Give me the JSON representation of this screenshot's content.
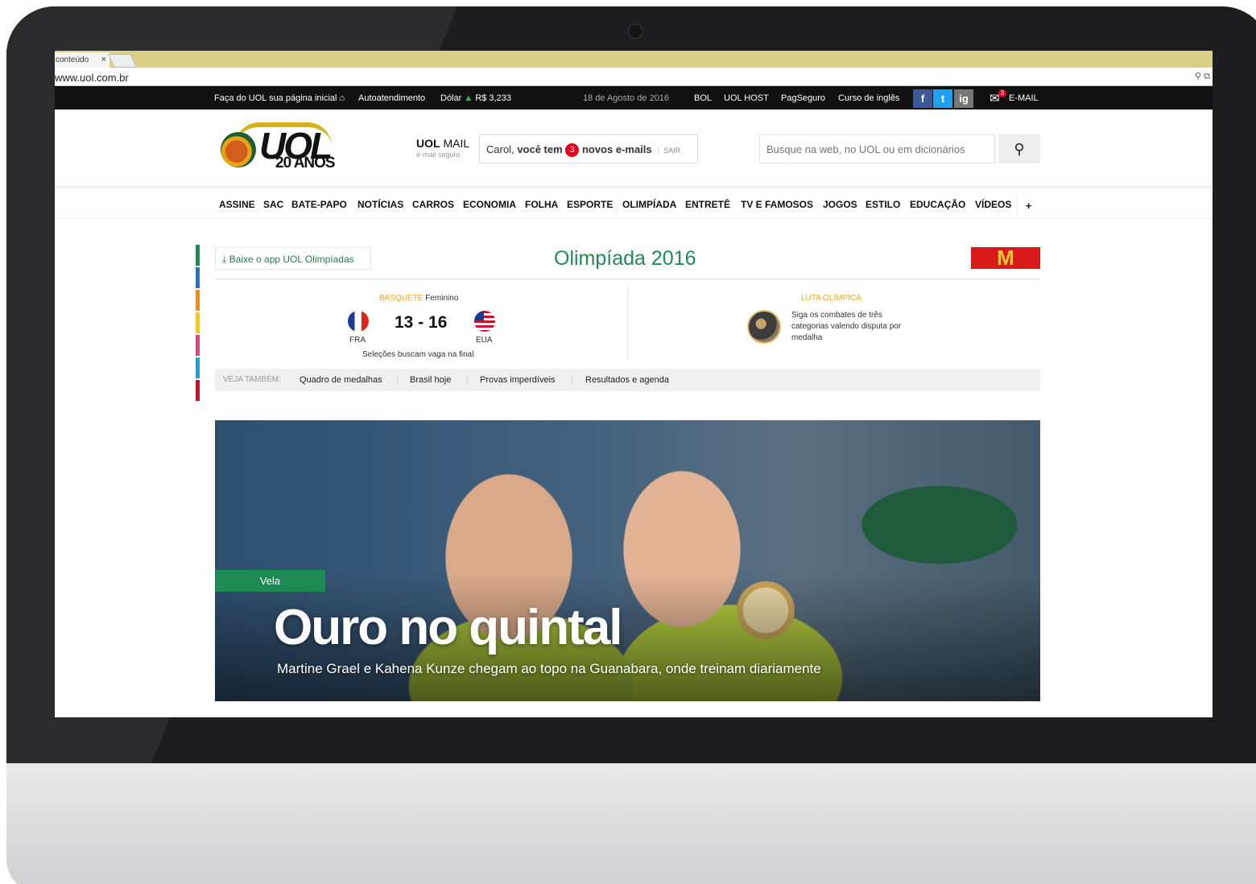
{
  "browser": {
    "tab_title": "conteúdo",
    "tab_close": "×",
    "url": "www.uol.com.br",
    "toolbar_icons": "⚲ ⧉"
  },
  "topbar": {
    "homepage_link": "Faça do UOL sua página inicial",
    "autoatendimento": "Autoatendimento",
    "dollar_label": "Dólar",
    "dollar_value": "R$ 3,233",
    "date": "18 de Agosto de 2016",
    "links": [
      "BOL",
      "UOL HOST",
      "PagSeguro",
      "Curso de inglês"
    ],
    "social": [
      "f",
      "t",
      "ig"
    ],
    "email_label": "E-MAIL",
    "email_badge": "3"
  },
  "header": {
    "logo_word": "UOL",
    "logo_sub": "20 ANOS",
    "mail_brand": "UOL",
    "mail_brand_suffix": "MAIL",
    "mail_sub": "e-mail seguro",
    "mail_greeting": "Carol,",
    "mail_you_have": "você tem",
    "mail_count": "3",
    "mail_new": "novos e-mails",
    "mail_logout": "SAIR",
    "search_placeholder": "Busque na web, no UOL ou em dicionários"
  },
  "nav": {
    "items": [
      "ASSINE",
      "SAC",
      "BATE-PAPO",
      "NOTÍCIAS",
      "CARROS",
      "ECONOMIA",
      "FOLHA",
      "ESPORTE",
      "OLIMPÍADA",
      "ENTRETÊ",
      "TV E FAMOSOS",
      "JOGOS",
      "ESTILO",
      "EDUCAÇÃO",
      "VÍDEOS"
    ],
    "more": "+"
  },
  "olympics": {
    "app_button": "Baixe o app UOL Olimpíadas",
    "title": "Olimpíada 2016",
    "sponsor_logo": "M",
    "bar_colors": [
      "#1e8a55",
      "#2c6fc6",
      "#f08a24",
      "#f5c518",
      "#e0457b",
      "#2a9bd6",
      "#c8102e"
    ],
    "match": {
      "sport": "BASQUETE",
      "gender": "Feminino",
      "score": "13 - 16",
      "team1": "FRA",
      "team2": "EUA",
      "note": "Seleções buscam vaga na final"
    },
    "feature": {
      "sport": "LUTA OLÍMPICA",
      "text": "Siga os combates de três categorias valendo disputa por medalha"
    },
    "see_also_label": "VEJA TAMBÉM:",
    "see_also": [
      "Quadro de medalhas",
      "Brasil hoje",
      "Provas imperdíveis",
      "Resultados e agenda"
    ]
  },
  "hero": {
    "tag": "Vela",
    "headline": "Ouro no quintal",
    "subhead": "Martine Grael e Kahena Kunze chegam ao topo na Guanabara, onde treinam diariamente"
  }
}
